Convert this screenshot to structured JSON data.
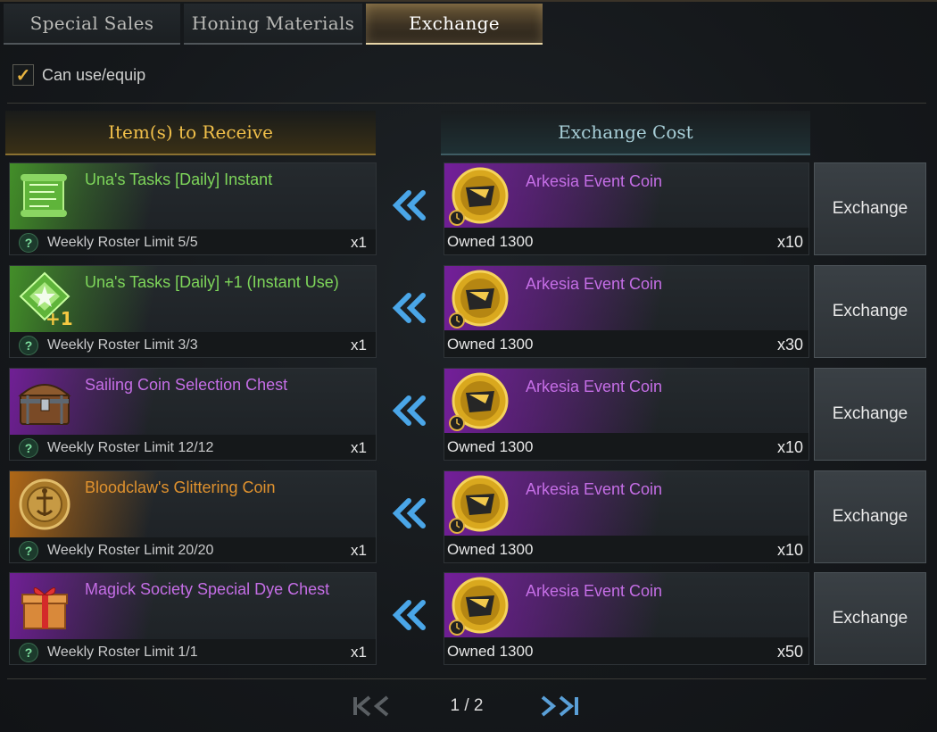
{
  "tabs": [
    {
      "label": "Special Sales",
      "active": false
    },
    {
      "label": "Honing Materials",
      "active": false
    },
    {
      "label": "Exchange",
      "active": true
    }
  ],
  "filter": {
    "label": "Can use/equip",
    "checked": true
  },
  "headers": {
    "receive": "Item(s) to Receive",
    "cost": "Exchange Cost"
  },
  "rows": [
    {
      "item_name": "Una's Tasks [Daily] Instant",
      "item_color": "#7ed65a",
      "item_icon": "scroll-icon",
      "grade": "green",
      "limit": "Weekly Roster Limit 5/5",
      "qty": "x1",
      "cost_name": "Arkesia Event Coin",
      "cost_icon": "event-coin-icon",
      "owned": "Owned 1300",
      "cost_qty": "x10",
      "button": "Exchange"
    },
    {
      "item_name": "Una's Tasks [Daily] +1 (Instant Use)",
      "item_color": "#7ed65a",
      "item_icon": "daily-plus-one-icon",
      "grade": "green",
      "limit": "Weekly Roster Limit 3/3",
      "qty": "x1",
      "cost_name": "Arkesia Event Coin",
      "cost_icon": "event-coin-icon",
      "owned": "Owned 1300",
      "cost_qty": "x30",
      "button": "Exchange"
    },
    {
      "item_name": "Sailing Coin Selection Chest",
      "item_color": "#c56ee6",
      "item_icon": "chest-icon",
      "grade": "purple",
      "limit": "Weekly Roster Limit 12/12",
      "qty": "x1",
      "cost_name": "Arkesia Event Coin",
      "cost_icon": "event-coin-icon",
      "owned": "Owned 1300",
      "cost_qty": "x10",
      "button": "Exchange"
    },
    {
      "item_name": "Bloodclaw's Glittering Coin",
      "item_color": "#e0922e",
      "item_icon": "glittering-coin-icon",
      "grade": "orange",
      "limit": "Weekly Roster Limit 20/20",
      "qty": "x1",
      "cost_name": "Arkesia Event Coin",
      "cost_icon": "event-coin-icon",
      "owned": "Owned 1300",
      "cost_qty": "x10",
      "button": "Exchange"
    },
    {
      "item_name": "Magick Society Special Dye Chest",
      "item_color": "#c56ee6",
      "item_icon": "gift-box-icon",
      "grade": "purple",
      "limit": "Weekly Roster Limit 1/1",
      "qty": "x1",
      "cost_name": "Arkesia Event Coin",
      "cost_icon": "event-coin-icon",
      "owned": "Owned 1300",
      "cost_qty": "x50",
      "button": "Exchange"
    }
  ],
  "pagination": {
    "label": "1 / 2",
    "current": 1,
    "total": 2
  },
  "icons": {
    "checkbox": "checkmark-icon",
    "help": "question-mark-icon",
    "exchange_direction": "double-chevron-left-icon",
    "pager": [
      "first-page-icon",
      "prev-page-icon",
      "next-page-icon",
      "last-page-icon"
    ]
  }
}
